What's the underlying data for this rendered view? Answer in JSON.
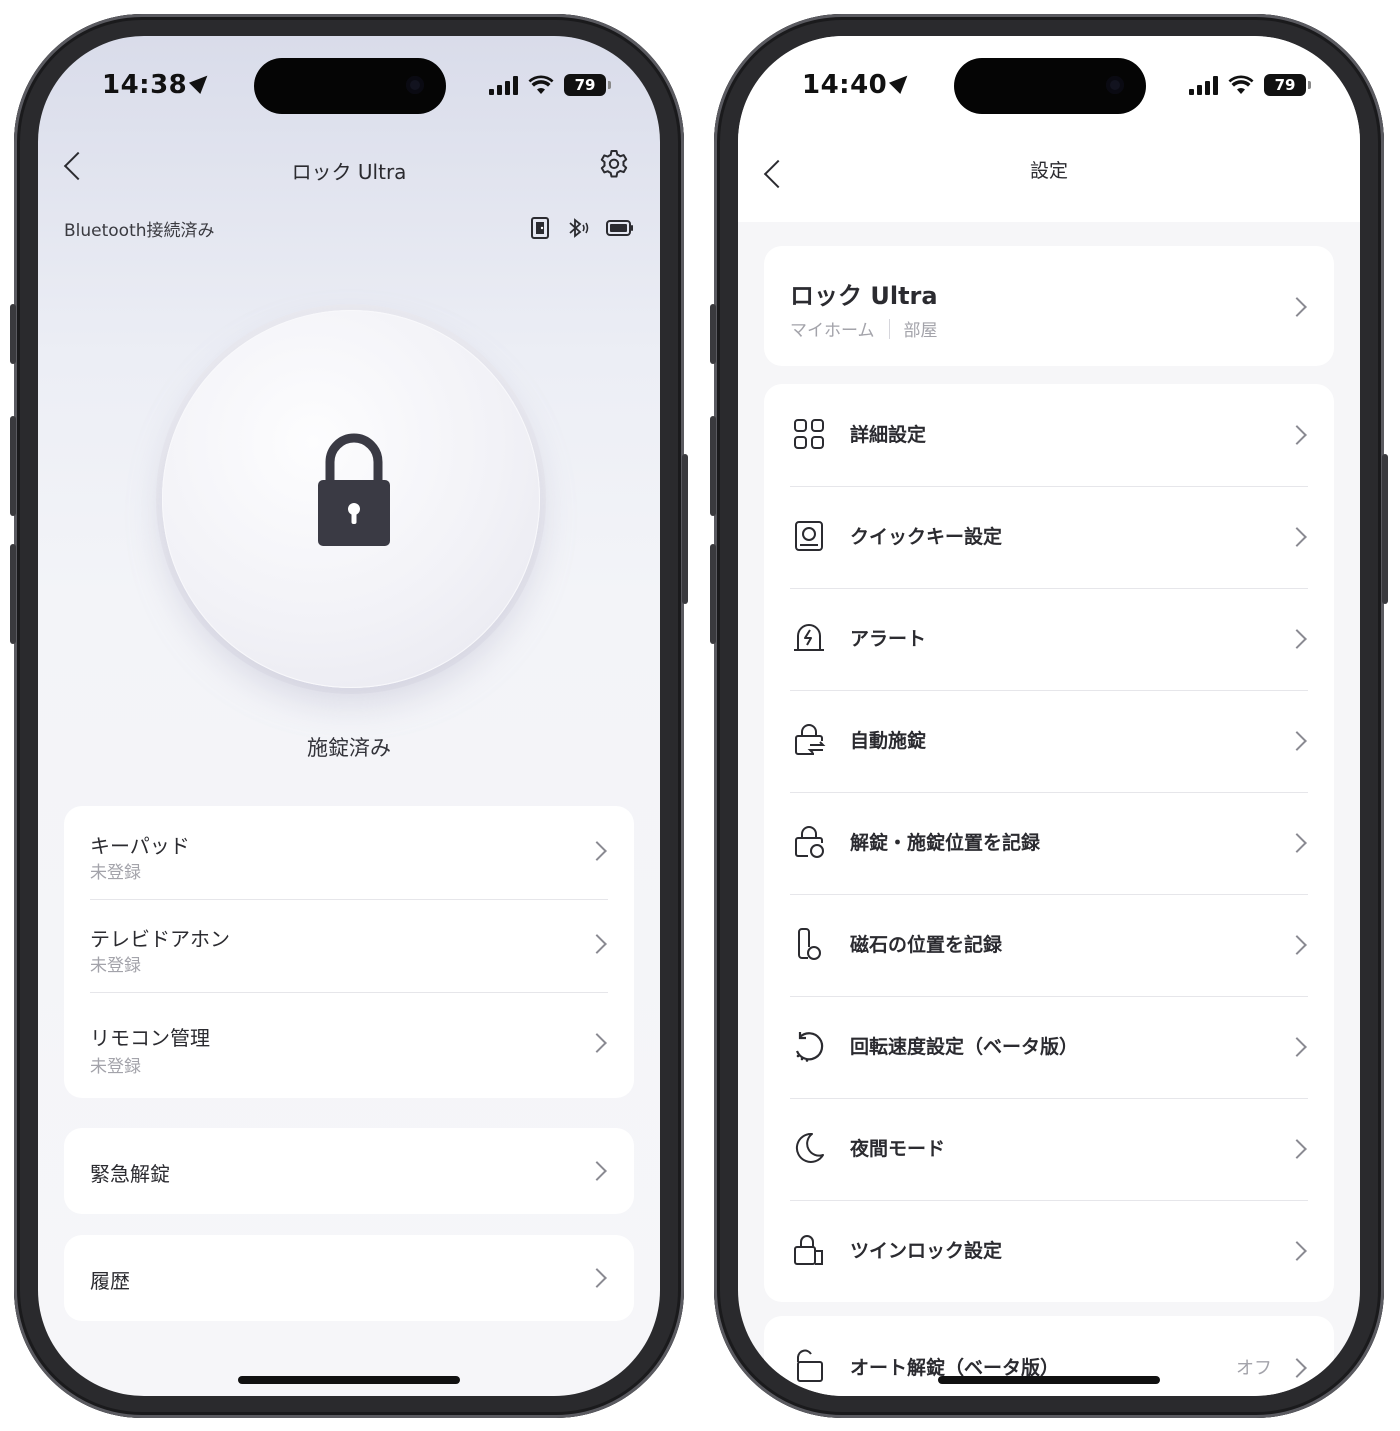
{
  "left_phone": {
    "status_bar": {
      "time": "14:38",
      "battery": "79"
    },
    "nav": {
      "title": "ロック Ultra"
    },
    "connection": {
      "label": "Bluetooth接続済み"
    },
    "lock": {
      "status": "施錠済み"
    },
    "accessories": [
      {
        "title": "キーパッド",
        "subtitle": "未登録"
      },
      {
        "title": "テレビドアホン",
        "subtitle": "未登録"
      },
      {
        "title": "リモコン管理",
        "subtitle": "未登録"
      }
    ],
    "emergency": {
      "label": "緊急解錠"
    },
    "history": {
      "label": "履歴"
    }
  },
  "right_phone": {
    "status_bar": {
      "time": "14:40",
      "battery": "79"
    },
    "nav": {
      "title": "設定"
    },
    "device": {
      "name": "ロック Ultra",
      "home": "マイホーム",
      "room": "部屋"
    },
    "menu": [
      {
        "label": "詳細設定",
        "icon": "grid-icon"
      },
      {
        "label": "クイックキー設定",
        "icon": "quick-key-icon"
      },
      {
        "label": "アラート",
        "icon": "alert-bell-icon"
      },
      {
        "label": "自動施錠",
        "icon": "auto-lock-icon"
      },
      {
        "label": "解錠・施錠位置を記録",
        "icon": "lock-position-icon"
      },
      {
        "label": "磁石の位置を記録",
        "icon": "magnet-position-icon"
      },
      {
        "label": "回転速度設定（ベータ版）",
        "icon": "rotation-icon"
      },
      {
        "label": "夜間モード",
        "icon": "moon-icon"
      },
      {
        "label": "ツインロック設定",
        "icon": "twin-lock-icon"
      }
    ],
    "auto_unlock": {
      "label": "オート解錠（ベータ版）",
      "value": "オフ"
    }
  }
}
